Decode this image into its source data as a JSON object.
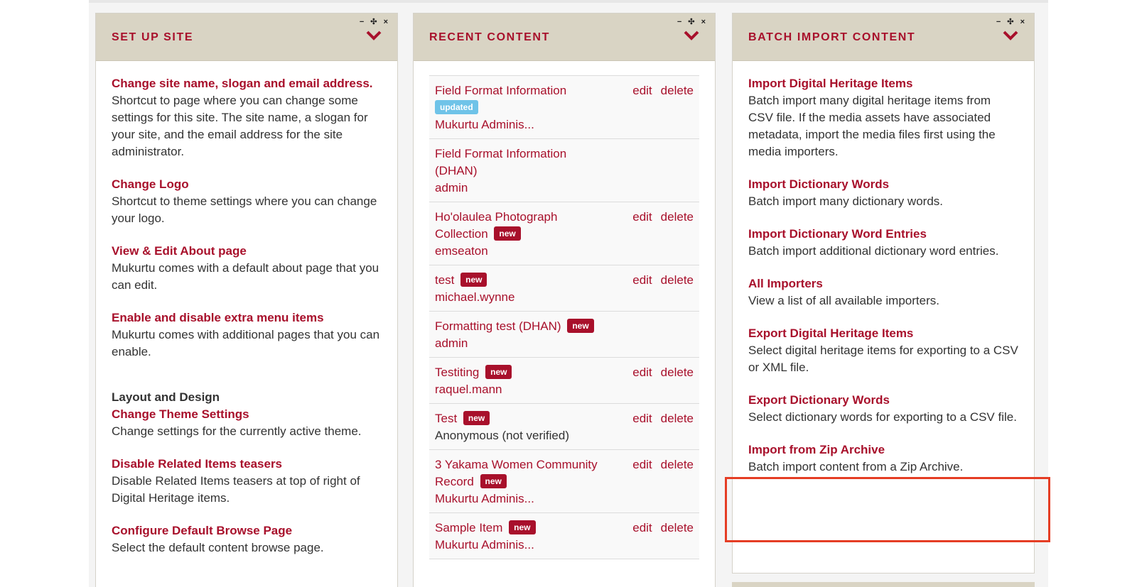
{
  "setup": {
    "title": "SET UP SITE",
    "controls": "− ✣ ×",
    "entries": [
      {
        "title": "Change site name, slogan and email address.",
        "desc": "Shortcut to page where you can change some settings for this site. The site name, a slogan for your site, and the email address for the site administrator."
      },
      {
        "title": "Change Logo",
        "desc": "Shortcut to theme settings where you can change your logo."
      },
      {
        "title": "View & Edit About page",
        "desc": "Mukurtu comes with a default about page that you can edit."
      },
      {
        "title": "Enable and disable extra menu items",
        "desc": "Mukurtu comes with additional pages that you can enable."
      }
    ],
    "section_label": "Layout and Design",
    "layout_entries": [
      {
        "title": "Change Theme Settings",
        "desc": "Change settings for the currently active theme."
      },
      {
        "title": "Disable Related Items teasers",
        "desc": "Disable Related Items teasers at top of right of Digital Heritage items."
      },
      {
        "title": "Configure Default Browse Page",
        "desc": "Select the default content browse page."
      }
    ]
  },
  "recent": {
    "title": "RECENT CONTENT",
    "controls": "− ✣ ×",
    "edit_label": "edit",
    "delete_label": "delete",
    "items": [
      {
        "title": "Field Format Information",
        "badge": "updated",
        "author": "Mukurtu Adminis...",
        "actions": true
      },
      {
        "title": "Field Format Information (DHAN)",
        "badge": "",
        "author": "admin",
        "actions": false
      },
      {
        "title": "Ho'olaulea Photograph Collection",
        "badge": "new",
        "author": "emseaton",
        "actions": true
      },
      {
        "title": "test",
        "badge": "new",
        "author": "michael.wynne",
        "actions": true
      },
      {
        "title": "Formatting test (DHAN)",
        "badge": "new",
        "author": "admin",
        "actions": false
      },
      {
        "title": "Testiting",
        "badge": "new",
        "author": "raquel.mann",
        "actions": true
      },
      {
        "title": "Test",
        "badge": "new",
        "author": "Anonymous (not verified)",
        "actions": true
      },
      {
        "title": "3 Yakama Women Community Record",
        "badge": "new",
        "author": "Mukurtu Adminis...",
        "actions": true
      },
      {
        "title": "Sample Item",
        "badge": "new",
        "author": "Mukurtu Adminis...",
        "actions": true
      }
    ]
  },
  "batch": {
    "title": "BATCH IMPORT CONTENT",
    "controls": "− ✣ ×",
    "entries": [
      {
        "title": "Import Digital Heritage Items",
        "desc": "Batch import many digital heritage items from CSV file. If the media assets have associated metadata, import the media files first using the media importers."
      },
      {
        "title": "Import Dictionary Words",
        "desc": "Batch import many dictionary words."
      },
      {
        "title": "Import Dictionary Word Entries",
        "desc": "Batch import additional dictionary word entries."
      },
      {
        "title": "All Importers",
        "desc": "View a list of all available importers."
      },
      {
        "title": "Export Digital Heritage Items",
        "desc": "Select digital heritage items for exporting to a CSV or XML file."
      },
      {
        "title": "Export Dictionary Words",
        "desc": "Select dictionary words for exporting to a CSV file."
      },
      {
        "title": "Import from Zip Archive",
        "desc": "Batch import content from a Zip Archive."
      }
    ]
  },
  "colors": {
    "accent": "#a8102b",
    "header_bg": "#d9d4c4",
    "highlight": "#e53d24",
    "badge_updated": "#6fc3e8"
  }
}
